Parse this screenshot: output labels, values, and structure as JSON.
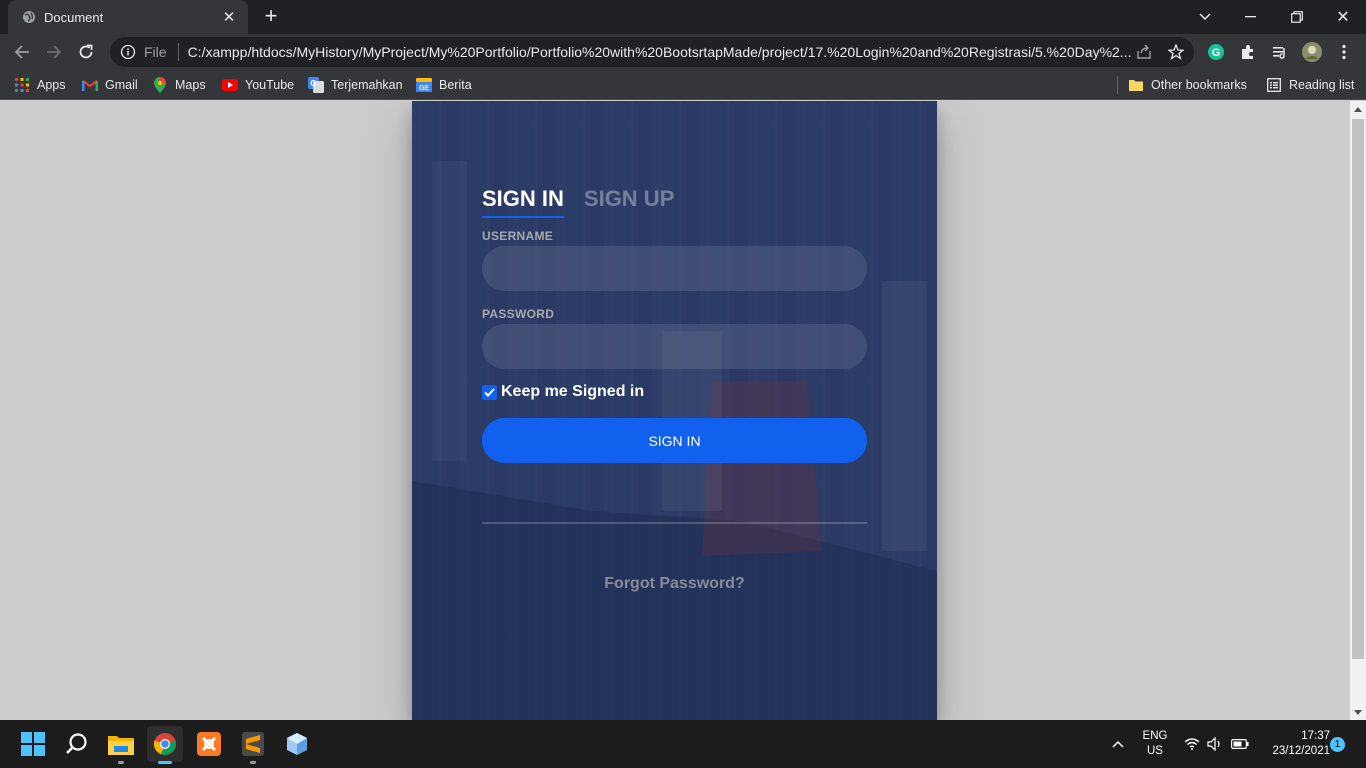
{
  "browser": {
    "tab_title": "Document",
    "url_scheme_label": "File",
    "url": "C:/xampp/htdocs/MyHistory/MyProject/My%20Portfolio/Portfolio%20with%20BootsrtapMade/project/17.%20Login%20and%20Registrasi/5.%20Day%2...",
    "bookmarks": [
      {
        "label": "Apps",
        "icon": "apps-grid-icon"
      },
      {
        "label": "Gmail",
        "icon": "gmail-icon"
      },
      {
        "label": "Maps",
        "icon": "maps-icon"
      },
      {
        "label": "YouTube",
        "icon": "youtube-icon"
      },
      {
        "label": "Terjemahkan",
        "icon": "translate-icon"
      },
      {
        "label": "Berita",
        "icon": "news-icon"
      }
    ],
    "other_bookmarks": "Other bookmarks",
    "reading_list": "Reading list"
  },
  "login": {
    "tab_signin": "SIGN IN",
    "tab_signup": "SIGN UP",
    "username_label": "USERNAME",
    "username_value": "",
    "password_label": "PASSWORD",
    "password_value": "",
    "keep_signed_in_label": "Keep me Signed in",
    "keep_signed_in_checked": true,
    "signin_button": "SIGN IN",
    "forgot_password": "Forgot Password?"
  },
  "taskbar": {
    "apps": [
      "windows-start-icon",
      "search-icon",
      "file-explorer-icon",
      "chrome-icon",
      "xampp-icon",
      "sublime-text-icon",
      "app-cube-icon"
    ],
    "language": "ENG",
    "region": "US",
    "time": "17:37",
    "date": "23/12/2021",
    "notification_count": "1"
  },
  "colors": {
    "accent": "#1161ee",
    "login_overlay": "#283965",
    "chrome_dark": "#202124",
    "chrome_toolbar": "#35363a"
  }
}
